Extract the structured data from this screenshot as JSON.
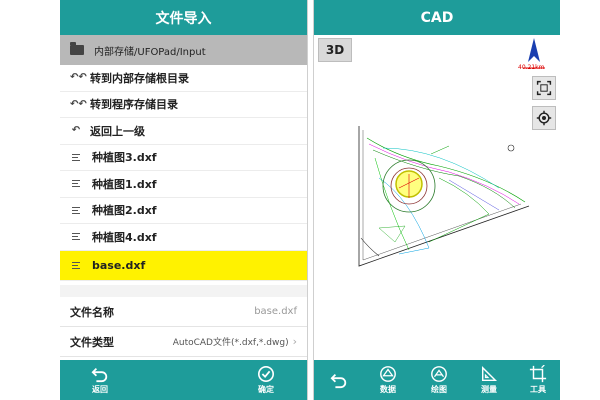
{
  "left": {
    "title": "文件导入",
    "path": "内部存储/UFOPad/Input",
    "items": [
      {
        "label": "转到内部存储根目录",
        "icon": "double-back-arrow-icon"
      },
      {
        "label": "转到程序存储目录",
        "icon": "double-back-arrow-icon"
      },
      {
        "label": "返回上一级",
        "icon": "back-arrow-icon"
      },
      {
        "label": "种植图3.dxf",
        "icon": "file-lines-icon"
      },
      {
        "label": "种植图1.dxf",
        "icon": "file-lines-icon"
      },
      {
        "label": "种植图2.dxf",
        "icon": "file-lines-icon"
      },
      {
        "label": "种植图4.dxf",
        "icon": "file-lines-icon"
      },
      {
        "label": "base.dxf",
        "icon": "file-lines-icon",
        "selected": true
      }
    ],
    "file_name_label": "文件名称",
    "file_name_value": "base.dxf",
    "file_type_label": "文件类型",
    "file_type_value": "AutoCAD文件(*.dxf,*.dwg)",
    "back_label": "返回",
    "confirm_label": "确定"
  },
  "right": {
    "title": "CAD",
    "btn_3d": "3D",
    "scale": "40.21km",
    "toolbar": {
      "data_label": "数据",
      "draw_label": "绘图",
      "measure_label": "测量",
      "tools_label": "工具"
    }
  },
  "colors": {
    "accent": "#1e9c9a",
    "selected": "#fff200",
    "path_bar": "#b8b8b8"
  }
}
